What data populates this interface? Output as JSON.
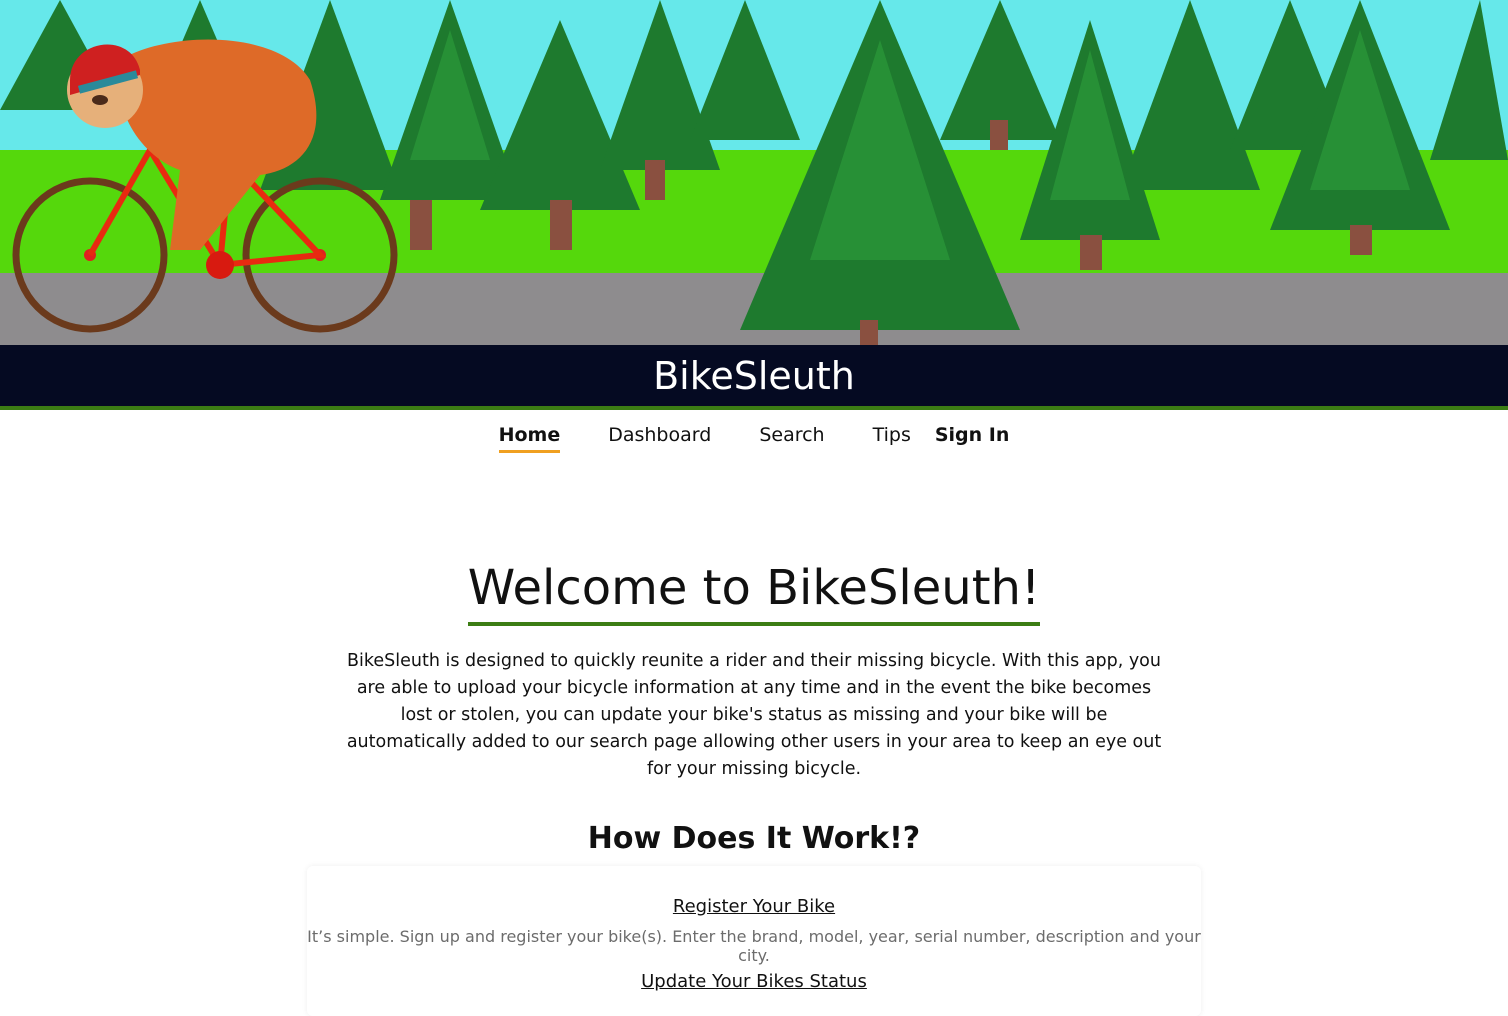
{
  "app": {
    "title": "BikeSleuth"
  },
  "nav": {
    "items": [
      {
        "label": "Home"
      },
      {
        "label": "Dashboard"
      },
      {
        "label": "Search"
      },
      {
        "label": "Tips"
      }
    ],
    "sign_in": "Sign In"
  },
  "welcome": {
    "heading": "Welcome to BikeSleuth!",
    "body": "BikeSleuth is designed to quickly reunite a rider and their missing bicycle. With this app, you are able to upload your bicycle information at any time and in the event the bike becomes lost or stolen, you can update your bike's status as missing and your bike will be automatically added to our search page allowing other users in your area to keep an eye out for your missing bicycle."
  },
  "how": {
    "heading": "How Does It Work!?",
    "steps": [
      {
        "title": "Register Your Bike",
        "text": "It’s simple. Sign up and register your bike(s). Enter the brand, model, year, serial number, description and your city."
      },
      {
        "title": "Update Your Bikes Status"
      }
    ]
  },
  "colors": {
    "header_bg": "#050a22",
    "accent_green": "#3c7d14",
    "nav_underline": "#f0a020"
  }
}
